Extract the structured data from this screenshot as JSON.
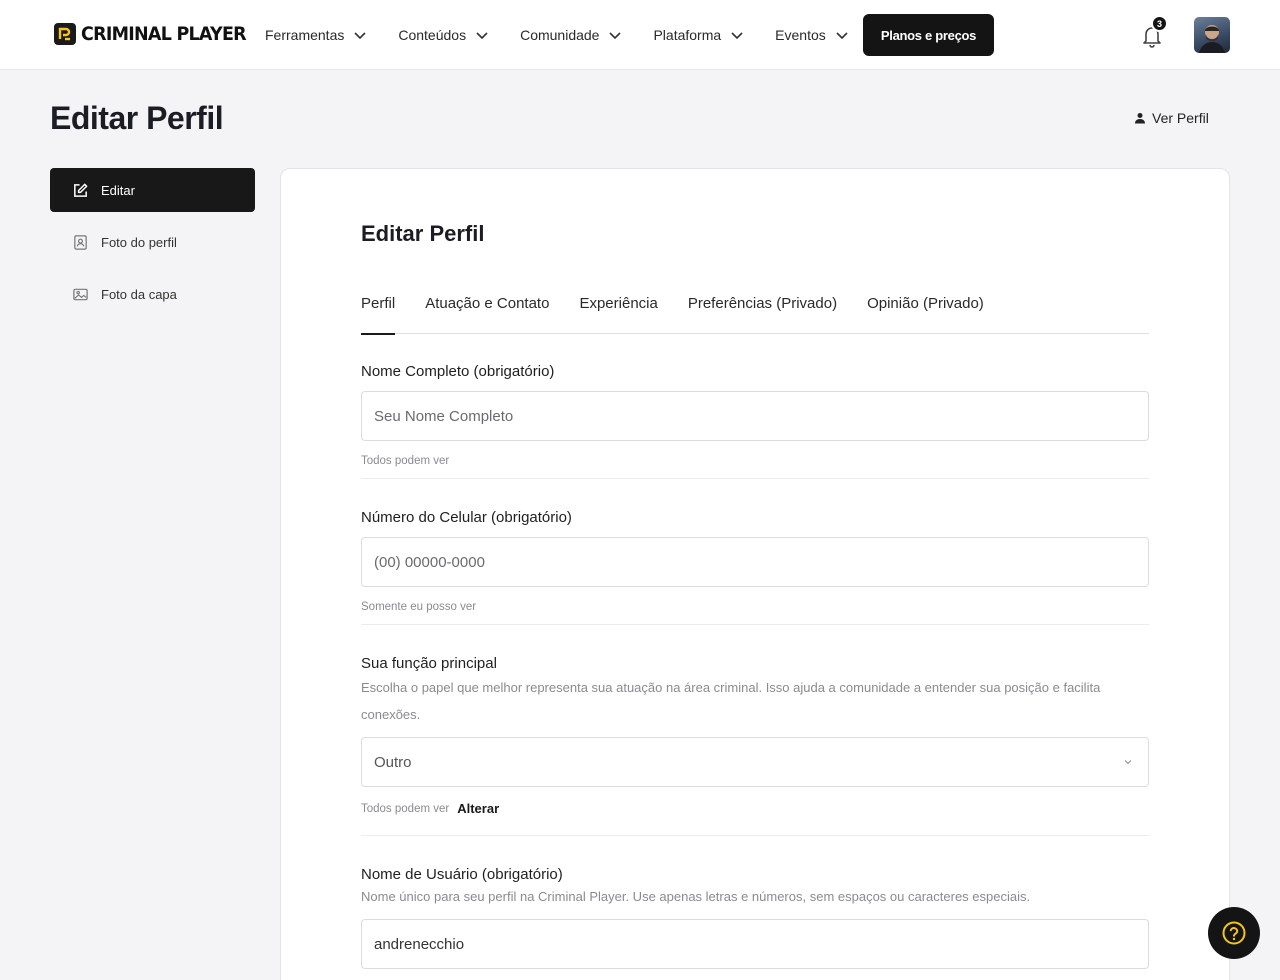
{
  "brand": {
    "name": "CRIMINAL PLAYER",
    "accent": "#f5c518"
  },
  "nav": [
    {
      "label": "Ferramentas",
      "icon": "chevron-down-icon"
    },
    {
      "label": "Conteúdos",
      "icon": "chevron-down-icon"
    },
    {
      "label": "Comunidade",
      "icon": "chevron-down-icon"
    },
    {
      "label": "Plataforma",
      "icon": "chevron-down-icon"
    },
    {
      "label": "Eventos",
      "icon": "chevron-down-icon"
    }
  ],
  "cta_label": "Planos e preços",
  "notifications": {
    "count": "3"
  },
  "page": {
    "title": "Editar Perfil",
    "view_profile": "Ver Perfil"
  },
  "sidebar": {
    "items": [
      {
        "label": "Editar",
        "icon": "edit-icon",
        "active": true
      },
      {
        "label": "Foto do perfil",
        "icon": "portrait-icon",
        "active": false
      },
      {
        "label": "Foto da capa",
        "icon": "image-icon",
        "active": false
      }
    ]
  },
  "card": {
    "title": "Editar Perfil"
  },
  "tabs": [
    {
      "label": "Perfil",
      "active": true
    },
    {
      "label": "Atuação e Contato"
    },
    {
      "label": "Experiência"
    },
    {
      "label": "Preferências (Privado)"
    },
    {
      "label": "Opinião (Privado)"
    }
  ],
  "fields": {
    "name": {
      "label": "Nome Completo (obrigatório)",
      "placeholder": "Seu Nome Completo",
      "value": "",
      "visibility": "Todos podem ver"
    },
    "phone": {
      "label": "Número do Celular (obrigatório)",
      "placeholder": "(00) 00000-0000",
      "value": "",
      "visibility": "Somente eu posso ver"
    },
    "role": {
      "label": "Sua função principal",
      "description": "Escolha o papel que melhor representa sua atuação na área criminal. Isso ajuda a comunidade a entender sua posição e facilita conexões.",
      "selected": "Outro",
      "visibility": "Todos podem ver",
      "change_link": "Alterar"
    },
    "username": {
      "label": "Nome de Usuário (obrigatório)",
      "description": "Nome único para seu perfil na Criminal Player. Use apenas letras e números, sem espaços ou caracteres especiais.",
      "value": "andrenecchio"
    }
  }
}
